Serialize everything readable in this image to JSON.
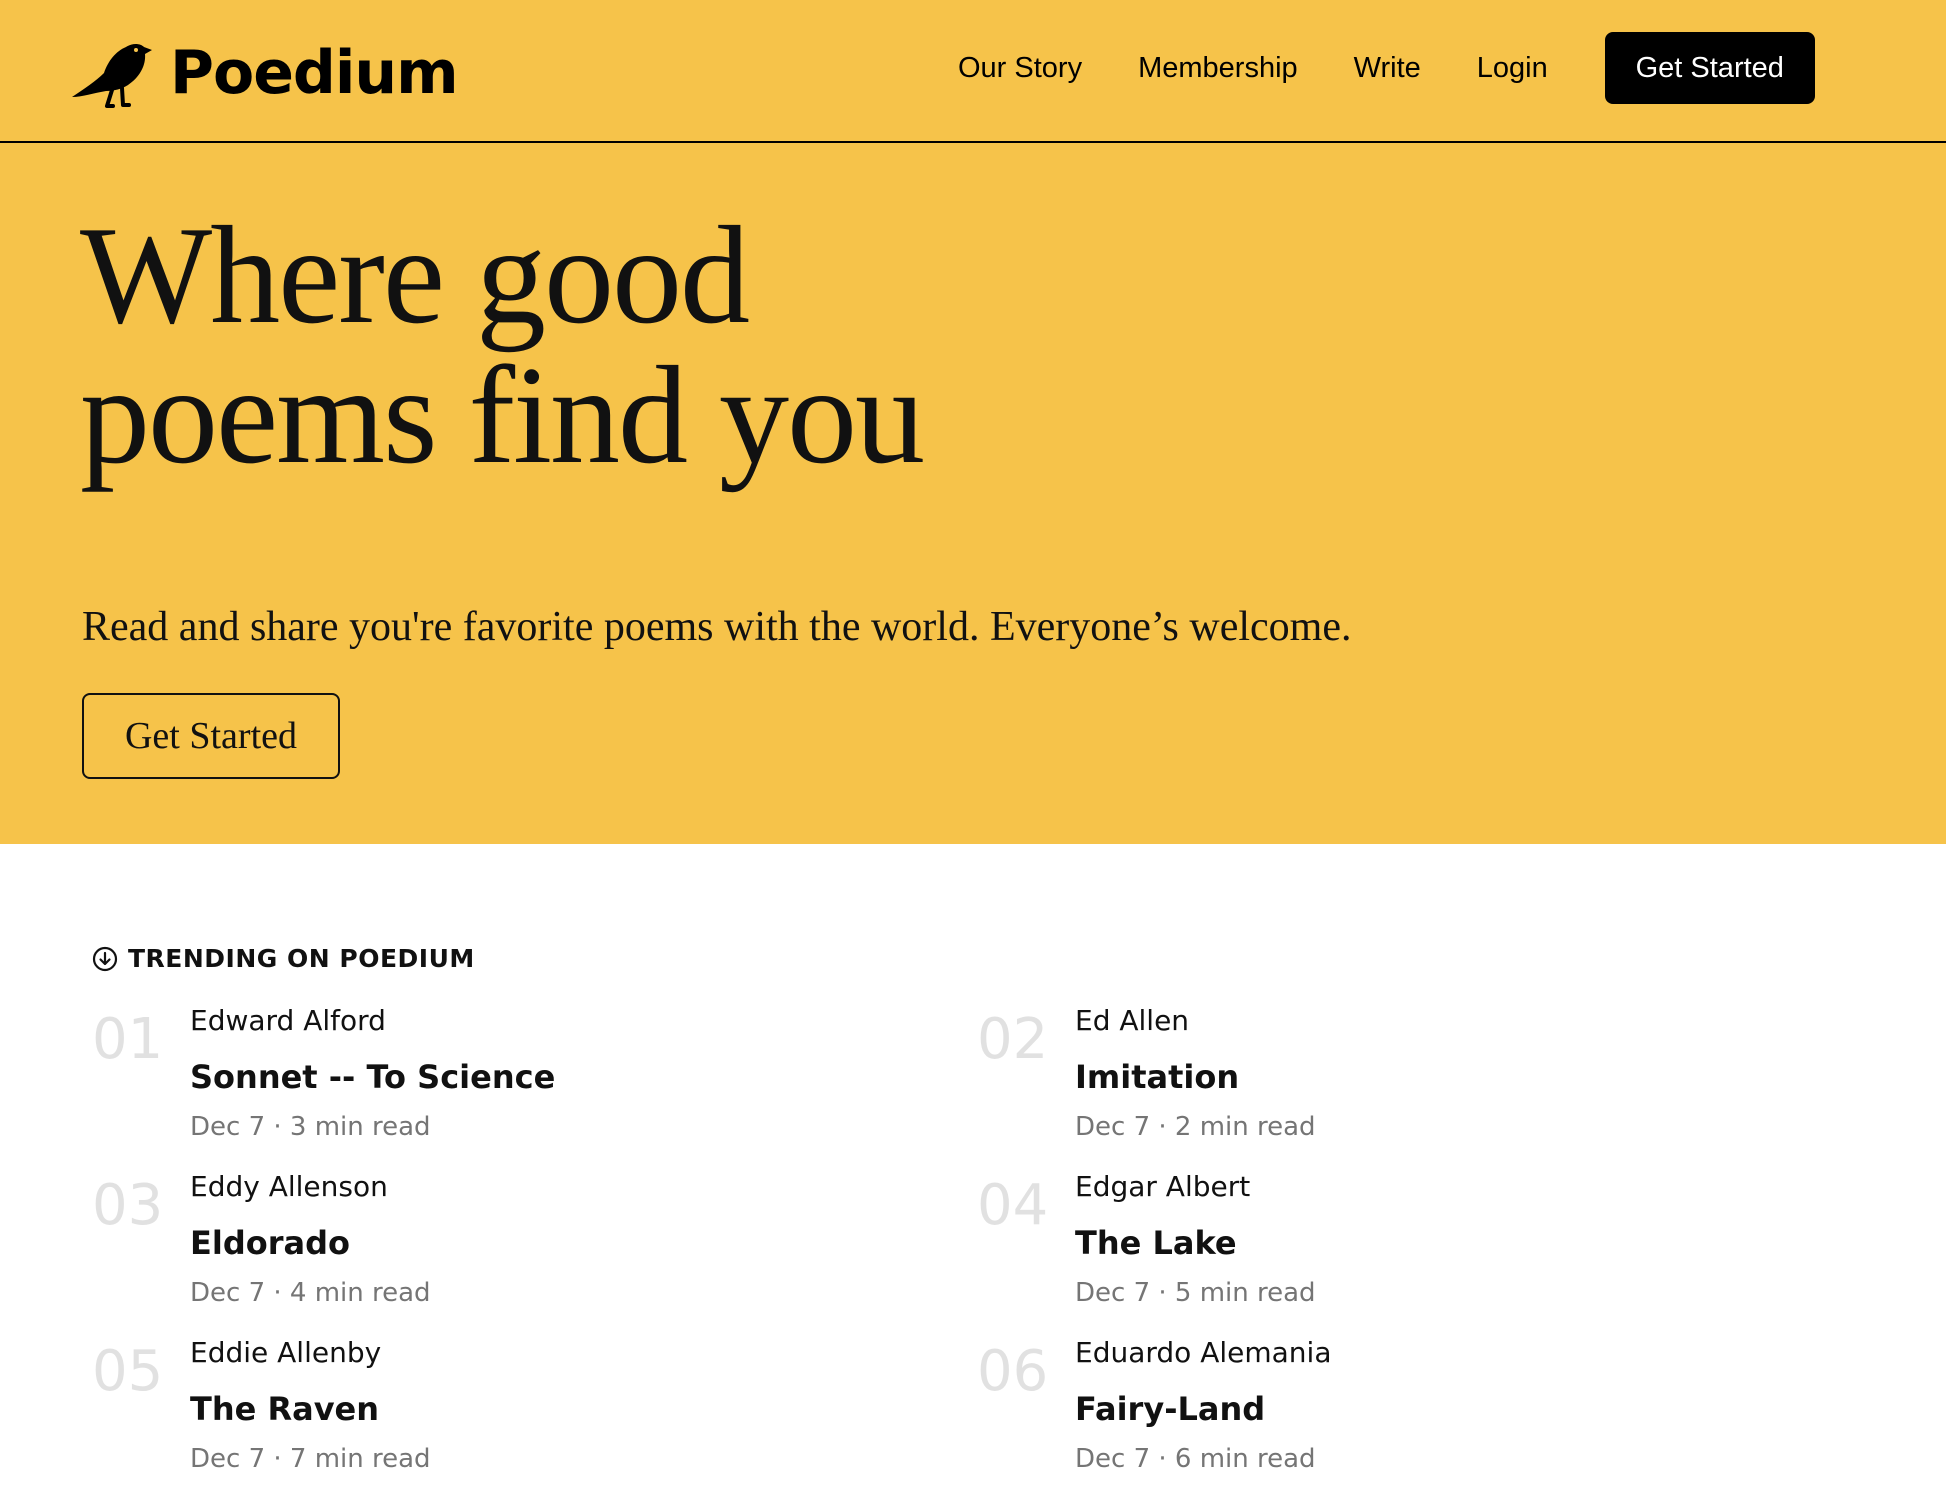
{
  "header": {
    "brand": "Poedium",
    "logo_icon": "crow-icon",
    "nav": [
      "Our Story",
      "Membership",
      "Write",
      "Login"
    ],
    "cta_label": "Get Started"
  },
  "hero": {
    "title_line1": "Where good",
    "title_line2": "poems find you",
    "subtitle": "Read and share you're favorite poems with the world. Everyone’s welcome.",
    "cta_label": "Get Started"
  },
  "trending": {
    "heading": "TRENDING ON POEDIUM",
    "icon": "trending-arrow-circle-icon",
    "items": [
      {
        "num": "01",
        "author": "Edward Alford",
        "title": "Sonnet -- To Science",
        "meta": "Dec 7 · 3 min read"
      },
      {
        "num": "02",
        "author": "Ed Allen",
        "title": "Imitation",
        "meta": "Dec 7 · 2 min read"
      },
      {
        "num": "03",
        "author": "Eddy Allenson",
        "title": "Eldorado",
        "meta": "Dec 7 · 4 min read"
      },
      {
        "num": "04",
        "author": "Edgar Albert",
        "title": "The Lake",
        "meta": "Dec 7 · 5 min read"
      },
      {
        "num": "05",
        "author": "Eddie Allenby",
        "title": "The Raven",
        "meta": "Dec 7 · 7 min read"
      },
      {
        "num": "06",
        "author": "Eduardo Alemania",
        "title": "Fairy-Land",
        "meta": "Dec 7 · 6 min read"
      }
    ]
  },
  "colors": {
    "brand_yellow": "#f6c34a",
    "text_dark": "#111111",
    "muted": "#757575",
    "number_gray": "#e1e1e1"
  }
}
